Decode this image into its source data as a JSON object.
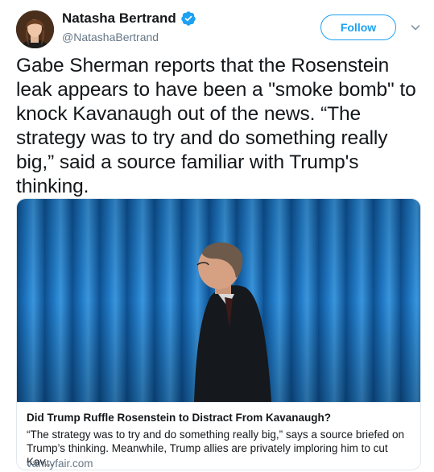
{
  "author": {
    "name": "Natasha Bertrand",
    "handle": "@NatashaBertrand",
    "verified": true,
    "avatar_icon": "profile-photo"
  },
  "follow_button": {
    "label": "Follow"
  },
  "caret_icon": "chevron-down-icon",
  "tweet": {
    "text": "Gabe Sherman reports that the Rosenstein leak appears to have been a \"smoke bomb\" to knock Kavanaugh out of the news. “The strategy was to try and do something really big,” said a source familiar with Trump's thinking."
  },
  "card": {
    "title": "Did Trump Ruffle Rosenstein to Distract From Kavanaugh?",
    "description": "“The strategy was to try and do something really big,” says a source briefed on Trump’s thinking. Meanwhile, Trump allies are privately imploring him to cut Kav...",
    "domain": "vanityfair.com"
  },
  "colors": {
    "accent": "#1da1f2",
    "text": "#14171a",
    "secondary": "#657786",
    "border": "#e1e8ed",
    "curtain": "#1f78c4"
  }
}
